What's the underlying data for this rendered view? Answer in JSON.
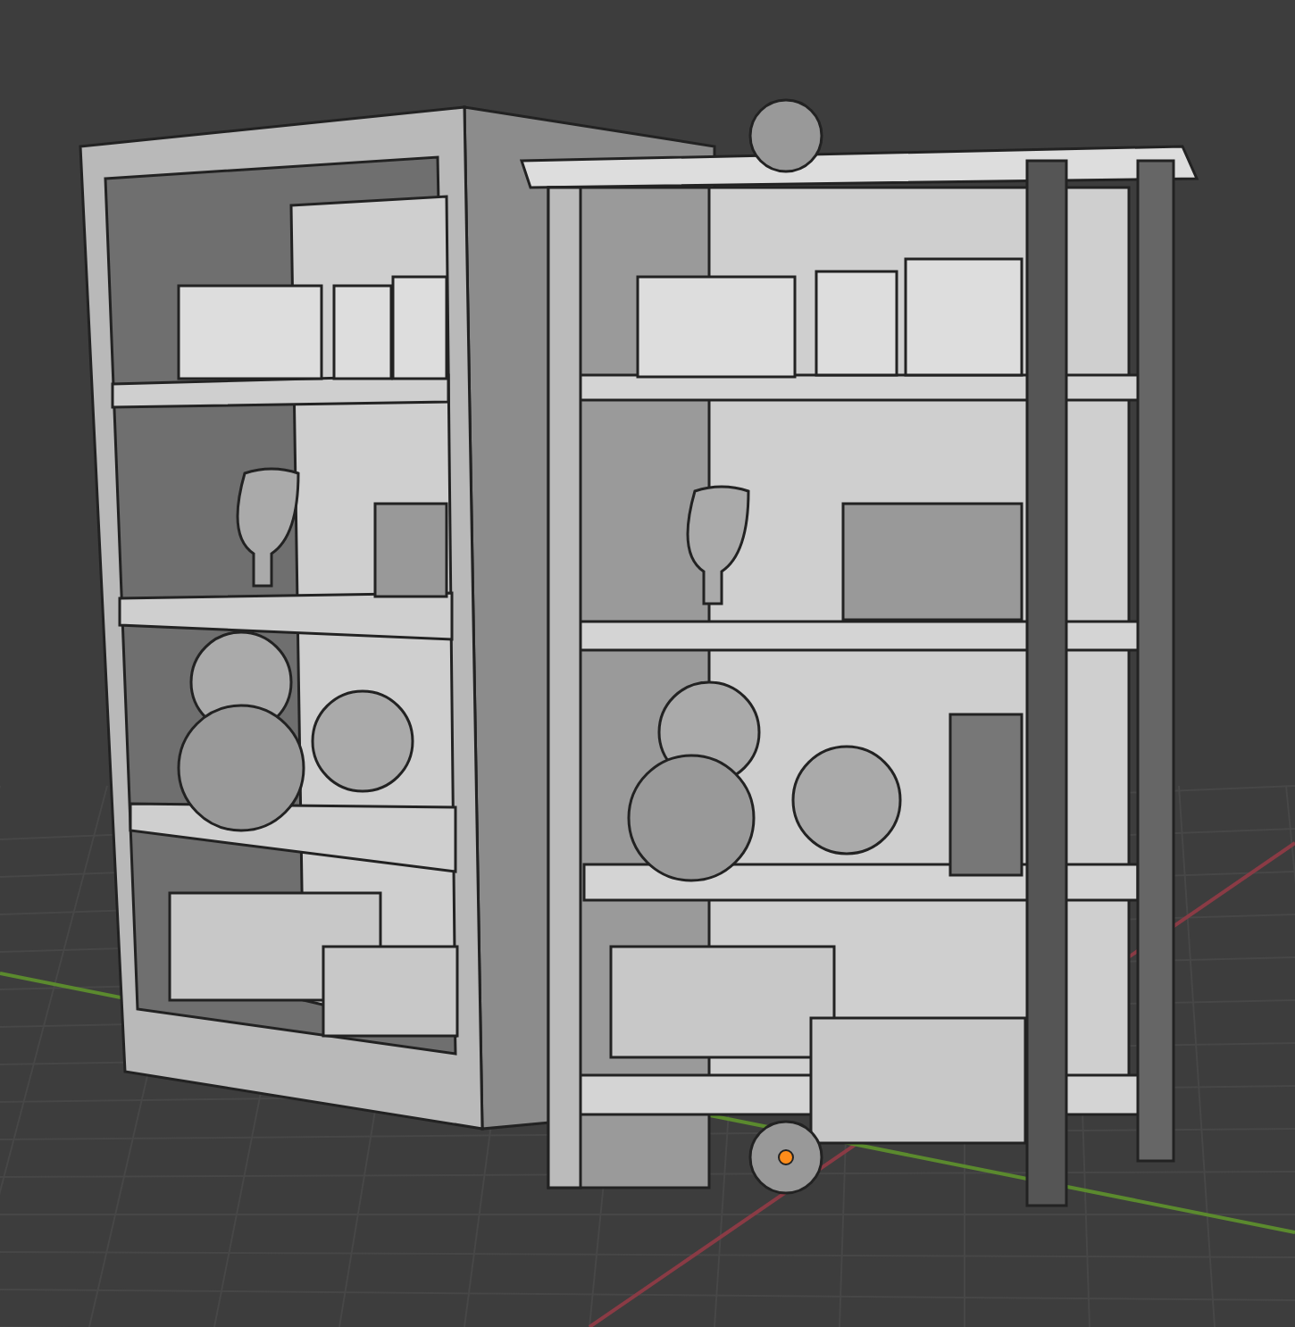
{
  "viewport": {
    "objects": [
      {
        "kind": "cabinet-shelf"
      },
      {
        "kind": "post-shelf"
      }
    ]
  }
}
